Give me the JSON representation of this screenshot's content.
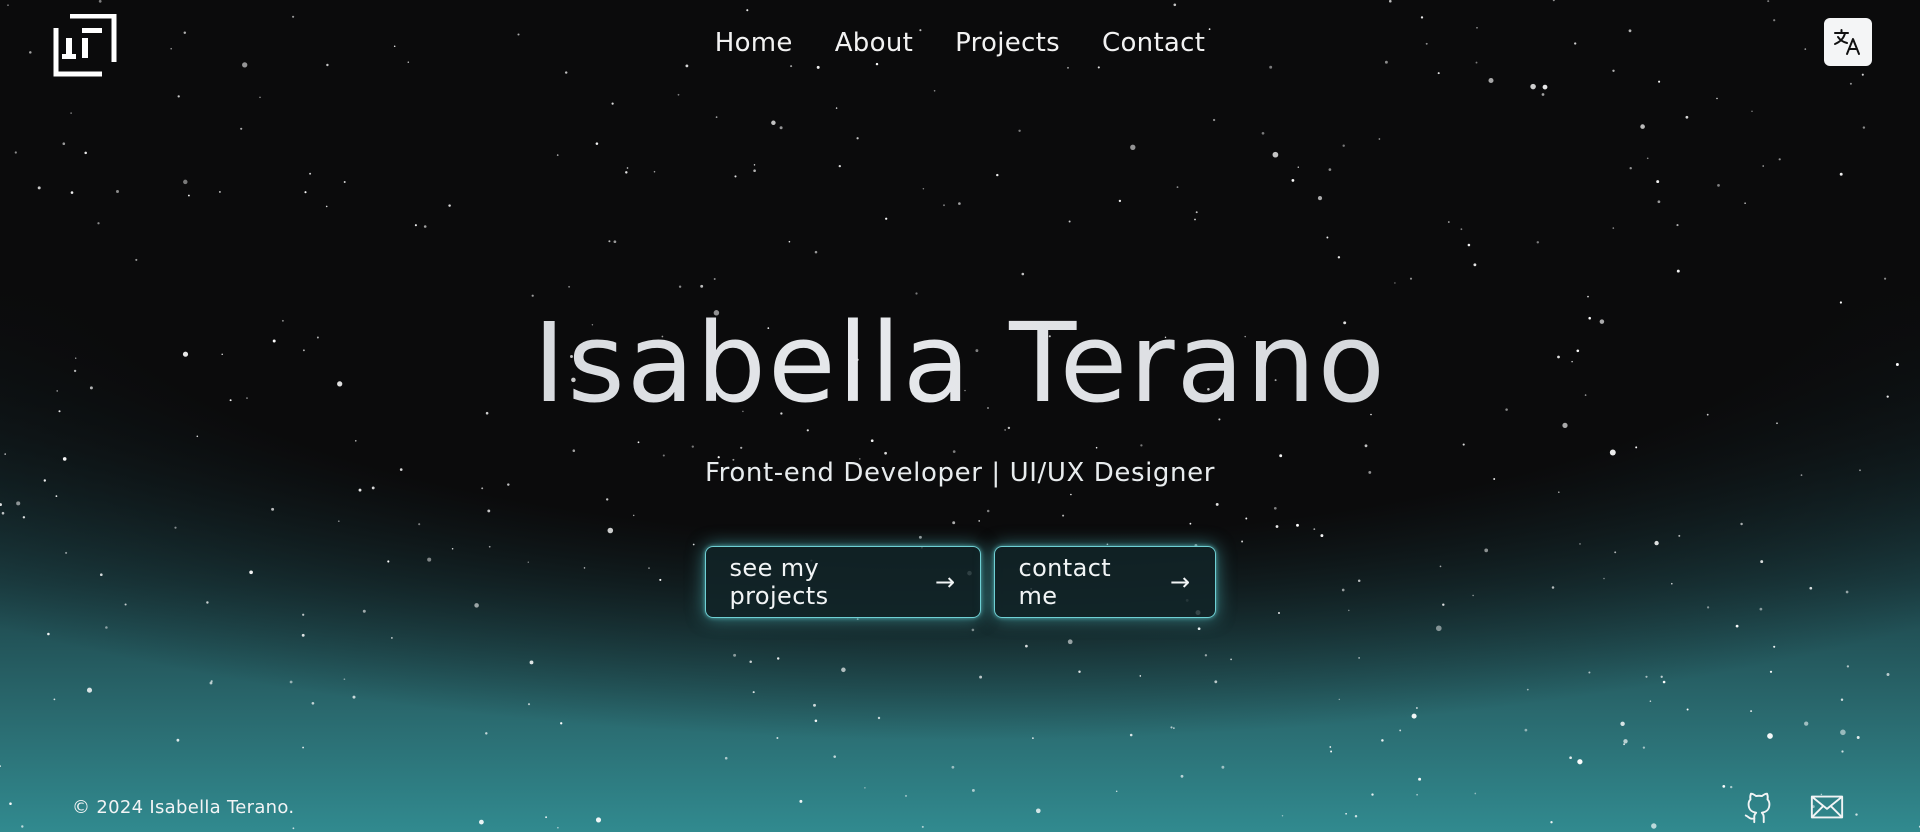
{
  "brand": {
    "logo_icon": "monogram-logo-icon"
  },
  "nav": {
    "items": [
      {
        "label": "Home"
      },
      {
        "label": "About"
      },
      {
        "label": "Projects"
      },
      {
        "label": "Contact"
      }
    ]
  },
  "language_toggle": {
    "icon": "translate-icon"
  },
  "hero": {
    "title": "Isabella Terano",
    "subtitle": "Front-end Developer | UI/UX Designer",
    "buttons": {
      "projects_label": "see my projects",
      "contact_label": "contact me",
      "arrow": "→"
    }
  },
  "footer": {
    "copyright": "© 2024 Isabella Terano.",
    "icons": [
      "github-icon",
      "mail-icon"
    ]
  },
  "colors": {
    "background": "#0b0b0c",
    "glow_teal": "#318a8f",
    "button_border": "#6fd0d4"
  }
}
